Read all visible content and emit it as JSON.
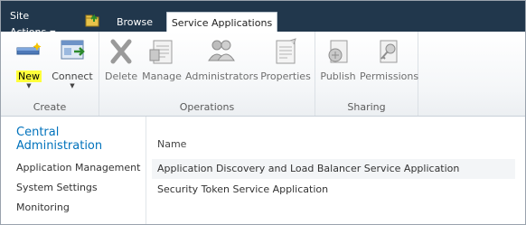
{
  "topbar": {
    "site_actions": "Site Actions",
    "tabs": [
      "Browse",
      "Service Applications"
    ]
  },
  "ribbon": {
    "groups": [
      {
        "label": "Create",
        "buttons": [
          "New",
          "Connect"
        ]
      },
      {
        "label": "Operations",
        "buttons": [
          "Delete",
          "Manage",
          "Administrators",
          "Properties"
        ]
      },
      {
        "label": "Sharing",
        "buttons": [
          "Publish",
          "Permissions"
        ]
      }
    ]
  },
  "leftnav": {
    "title": "Central Administration",
    "items": [
      "Application Management",
      "System Settings",
      "Monitoring"
    ]
  },
  "list": {
    "column_header": "Name",
    "rows": [
      "Application Discovery and Load Balancer Service Application",
      "Security Token Service Application"
    ]
  },
  "colors": {
    "topbar": "#21374c",
    "link": "#0072bc",
    "highlight": "#ffff3b"
  }
}
